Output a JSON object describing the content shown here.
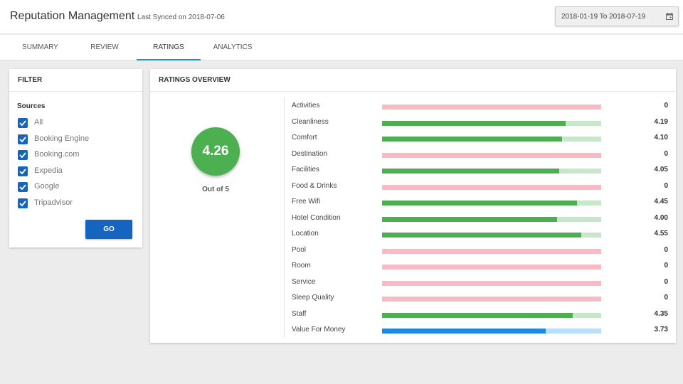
{
  "header": {
    "title": "Reputation Management",
    "sync_text": "Last Synced on 2018-07-06",
    "date_range": "2018-01-19 To 2018-07-19"
  },
  "tabs": [
    {
      "label": "SUMMARY",
      "active": false
    },
    {
      "label": "REVIEW",
      "active": false
    },
    {
      "label": "RATINGS",
      "active": true
    },
    {
      "label": "ANALYTICS",
      "active": false
    }
  ],
  "filter": {
    "title": "FILTER",
    "sources_label": "Sources",
    "sources": [
      {
        "label": "All",
        "checked": true
      },
      {
        "label": "Booking Engine",
        "checked": true
      },
      {
        "label": "Booking.com",
        "checked": true
      },
      {
        "label": "Expedia",
        "checked": true
      },
      {
        "label": "Google",
        "checked": true
      },
      {
        "label": "Tripadvisor",
        "checked": true
      }
    ],
    "go_label": "GO"
  },
  "ratings": {
    "title": "RATINGS OVERVIEW",
    "overall": "4.26",
    "out_of": "Out of 5",
    "scale_max": 5,
    "colors": {
      "good_fill": "#4caf50",
      "good_track": "#c8e6c9",
      "mid_fill": "#1e88e5",
      "mid_track": "#bbdefb",
      "zero_track": "#f8bbc4"
    },
    "items": [
      {
        "name": "Activities",
        "value": "0"
      },
      {
        "name": "Cleanliness",
        "value": "4.19"
      },
      {
        "name": "Comfort",
        "value": "4.10"
      },
      {
        "name": "Destination",
        "value": "0"
      },
      {
        "name": "Facilities",
        "value": "4.05"
      },
      {
        "name": "Food & Drinks",
        "value": "0"
      },
      {
        "name": "Free Wifi",
        "value": "4.45"
      },
      {
        "name": "Hotel Condition",
        "value": "4.00"
      },
      {
        "name": "Location",
        "value": "4.55"
      },
      {
        "name": "Pool",
        "value": "0"
      },
      {
        "name": "Room",
        "value": "0"
      },
      {
        "name": "Service",
        "value": "0"
      },
      {
        "name": "Sleep Quality",
        "value": "0"
      },
      {
        "name": "Staff",
        "value": "4.35"
      },
      {
        "name": "Value For Money",
        "value": "3.73"
      }
    ]
  }
}
